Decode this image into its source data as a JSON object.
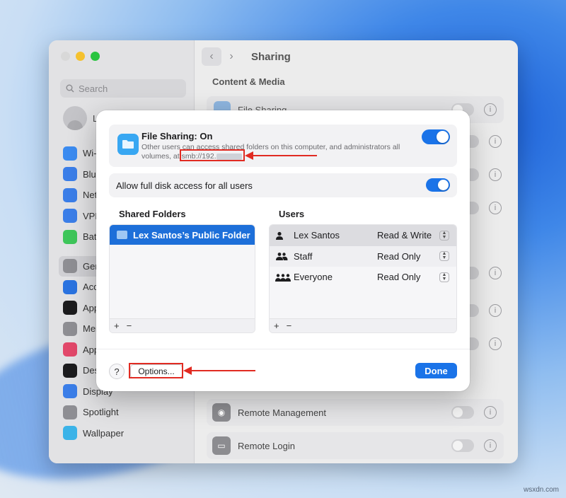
{
  "window": {
    "toolbar_title": "Sharing",
    "section_heading": "Content & Media",
    "search_placeholder": "Search",
    "profile_name": "Le",
    "sidebar": [
      {
        "label": "Wi-",
        "color": "#3b8bf0"
      },
      {
        "label": "Blue",
        "color": "#3b7ee8"
      },
      {
        "label": "Netw",
        "color": "#3b7ee8"
      },
      {
        "label": "VPN",
        "color": "#3b7ee8"
      },
      {
        "label": "Batt",
        "color": "#3ec65a"
      },
      {
        "label": "Gen",
        "color": "#8e8e93",
        "selected": true
      },
      {
        "label": "Acce",
        "color": "#2a73e0"
      },
      {
        "label": "Appe",
        "color": "#1c1c1e"
      },
      {
        "label": "Men",
        "color": "#8e8e93"
      },
      {
        "label": "Appl",
        "color": "#e2486a"
      },
      {
        "label": "Desk",
        "color": "#1c1c1e"
      },
      {
        "label": "Display",
        "color": "#3b7ee8"
      },
      {
        "label": "Spotlight",
        "color": "#8e8e93"
      },
      {
        "label": "Wallpaper",
        "color": "#3bb3e8"
      }
    ],
    "bg_rows": {
      "file_sharing": "File Sharing",
      "remote_management": "Remote Management",
      "remote_login": "Remote Login"
    }
  },
  "dialog": {
    "file_sharing": {
      "title": "File Sharing: On",
      "description_pre": "Other users can access shared folders on this computer, and administrators all volumes, at ",
      "address": "smb://192.",
      "enabled": true
    },
    "full_disk": {
      "label": "Allow full disk access for all users",
      "enabled": true
    },
    "shared_folders": {
      "heading": "Shared Folders",
      "items": [
        "Lex Santos’s Public Folder"
      ],
      "add": "+",
      "remove": "−"
    },
    "users": {
      "heading": "Users",
      "rows": [
        {
          "name": "Lex Santos",
          "permission": "Read & Write",
          "icon": "person-icon"
        },
        {
          "name": "Staff",
          "permission": "Read Only",
          "icon": "group-icon"
        },
        {
          "name": "Everyone",
          "permission": "Read Only",
          "icon": "everyone-icon"
        }
      ],
      "add": "+",
      "remove": "−"
    },
    "help_label": "?",
    "options_label": "Options...",
    "done_label": "Done"
  },
  "watermark": "wsxdn.com",
  "colors": {
    "accent": "#1a73e8",
    "annotation": "#e12b22",
    "selection": "#1d6fd9"
  }
}
